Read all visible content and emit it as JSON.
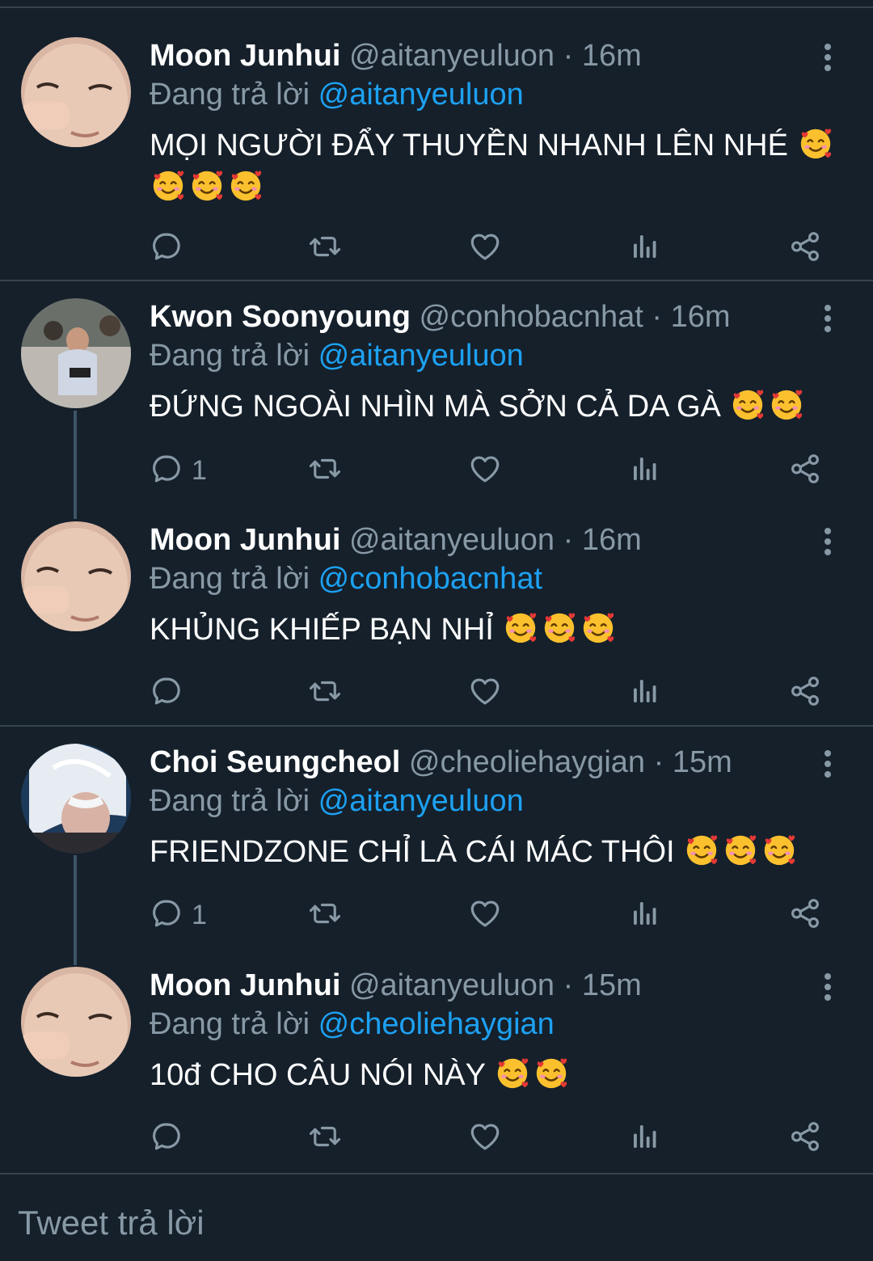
{
  "tweets": [
    {
      "name": "Moon Junhui",
      "handle": "@aitanyeuluon",
      "sep": "·",
      "time": "16m",
      "replying_prefix": "Đang trả lời",
      "replying_to": "@aitanyeuluon",
      "text": "MỌI NGƯỜI ĐẨY THUYỀN NHANH LÊN NHÉ",
      "emoji_count": 4,
      "reply_count": "",
      "avatar": "avatar-junhui"
    },
    {
      "name": "Kwon Soonyoung",
      "handle": "@conhobacnhat",
      "sep": "·",
      "time": "16m",
      "replying_prefix": "Đang trả lời",
      "replying_to": "@aitanyeuluon",
      "text": "ĐỨNG NGOÀI NHÌN MÀ SỞN CẢ DA GÀ",
      "emoji_count": 2,
      "reply_count": "1",
      "avatar": "avatar-soonyoung"
    },
    {
      "name": "Moon Junhui",
      "handle": "@aitanyeuluon",
      "sep": "·",
      "time": "16m",
      "replying_prefix": "Đang trả lời",
      "replying_to": "@conhobacnhat",
      "text": "KHỦNG KHIẾP BẠN NHỈ",
      "emoji_count": 3,
      "reply_count": "",
      "avatar": "avatar-junhui"
    },
    {
      "name": "Choi Seungcheol",
      "handle": "@cheoliehaygian",
      "sep": "·",
      "time": "15m",
      "replying_prefix": "Đang trả lời",
      "replying_to": "@aitanyeuluon",
      "text": "FRIENDZONE CHỈ LÀ CÁI MÁC THÔI",
      "emoji_count": 3,
      "reply_count": "1",
      "avatar": "avatar-seungcheol"
    },
    {
      "name": "Moon Junhui",
      "handle": "@aitanyeuluon",
      "sep": "·",
      "time": "15m",
      "replying_prefix": "Đang trả lời",
      "replying_to": "@cheoliehaygian",
      "text": "10đ CHO CÂU NÓI NÀY",
      "emoji_count": 2,
      "reply_count": "",
      "avatar": "avatar-junhui"
    }
  ],
  "reply_bar": {
    "placeholder": "Tweet trả lời"
  },
  "icons": {
    "emoji": "smiling-face-with-hearts-icon",
    "actions": [
      "reply-icon",
      "retweet-icon",
      "like-icon",
      "analytics-icon",
      "share-icon"
    ],
    "more": "more-vertical-icon"
  },
  "colors": {
    "background": "#15202b",
    "text": "#ffffff",
    "secondary": "#8899a6",
    "link": "#1da1f2",
    "divider": "#38444d"
  }
}
